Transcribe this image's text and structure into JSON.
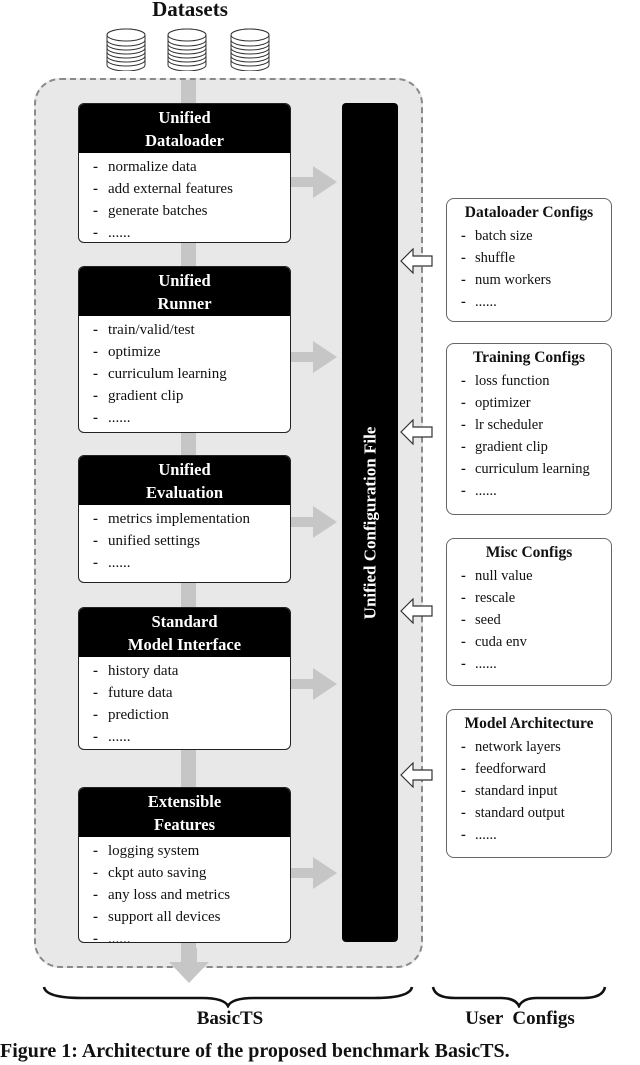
{
  "header": {
    "title": "Datasets"
  },
  "datasets": [
    {
      "icon": "database-icon"
    },
    {
      "icon": "database-icon"
    },
    {
      "icon": "database-icon"
    }
  ],
  "modules": [
    {
      "title_line1": "Unified",
      "title_line2": "Dataloader",
      "items": [
        "normalize data",
        "add external features",
        "generate batches",
        "......"
      ]
    },
    {
      "title_line1": "Unified",
      "title_line2": "Runner",
      "items": [
        "train/valid/test",
        "optimize",
        "curriculum learning",
        "gradient clip",
        "......"
      ]
    },
    {
      "title_line1": "Unified",
      "title_line2": "Evaluation",
      "items": [
        "metrics implementation",
        "unified settings",
        "......"
      ]
    },
    {
      "title_line1": "Standard",
      "title_line2": "Model Interface",
      "items": [
        "history data",
        "future data",
        "prediction",
        "......"
      ]
    },
    {
      "title_line1": "Extensible",
      "title_line2": "Features",
      "items": [
        "logging system",
        "ckpt auto saving",
        "any loss and metrics",
        "support all devices",
        "......"
      ]
    }
  ],
  "config_file": {
    "label": "Unified Configuration File"
  },
  "user_configs": [
    {
      "title": "Dataloader Configs",
      "items": [
        "batch size",
        "shuffle",
        "num workers",
        "......"
      ]
    },
    {
      "title": "Training Configs",
      "items": [
        "loss function",
        "optimizer",
        "lr scheduler",
        "gradient clip",
        "curriculum learning",
        "......"
      ]
    },
    {
      "title": "Misc Configs",
      "items": [
        "null value",
        "rescale",
        "seed",
        "cuda env",
        "......"
      ]
    },
    {
      "title": "Model Architecture",
      "items": [
        "network layers",
        "feedforward",
        "standard input",
        "standard output",
        "......"
      ]
    }
  ],
  "groups": {
    "left": "BasicTS",
    "right": "User  Configs"
  },
  "caption": "Figure 1: Architecture of the proposed benchmark BasicTS.",
  "colors": {
    "container_bg": "#e8e8e8",
    "arrow_gray": "#c6c6c6",
    "header_black": "#000000"
  }
}
